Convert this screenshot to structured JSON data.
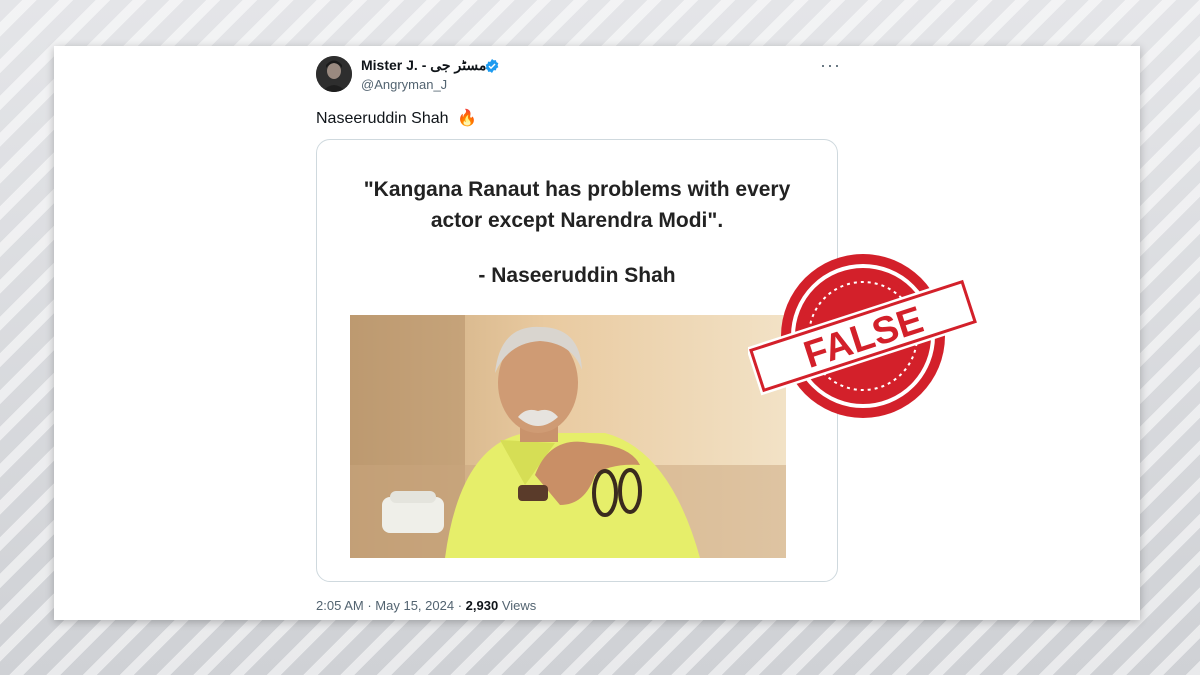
{
  "tweet": {
    "author_name": "Mister J. - مسٹر جی",
    "handle": "@Angryman_J",
    "text": "Naseeruddin Shah",
    "emoji": "🔥",
    "more_label": "···",
    "time": "2:05 AM",
    "separator": "·",
    "date": "May 15, 2024",
    "views_count": "2,930",
    "views_label": "Views"
  },
  "media": {
    "quote": "\"Kangana Ranaut has problems with every\nactor except Narendra Modi\".",
    "attribution": "- Naseeruddin Shah"
  },
  "stamp": {
    "label": "FALSE",
    "color": "#d3202a"
  },
  "colors": {
    "verified": "#1d9bf0",
    "photo_background": "#e8c89a",
    "shirt": "#e8f06a"
  },
  "icons": [
    "verified-badge-icon",
    "more-options-icon",
    "fire-emoji-icon"
  ]
}
